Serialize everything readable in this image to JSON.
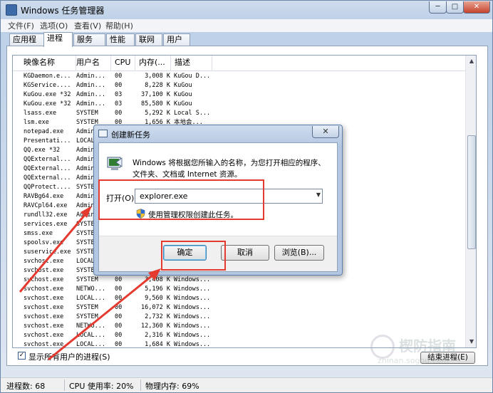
{
  "window": {
    "title": "Windows 任务管理器",
    "controls": {
      "minimize": "─",
      "maximize": "□",
      "close": "✕"
    }
  },
  "menu": [
    "文件(F)",
    "选项(O)",
    "查看(V)",
    "帮助(H)"
  ],
  "tabs": [
    "应用程序",
    "进程",
    "服务",
    "性能",
    "联网",
    "用户"
  ],
  "active_tab": "进程",
  "columns": [
    "映像名称",
    "用户名",
    "CPU",
    "内存(...",
    "描述"
  ],
  "processes": [
    [
      "KGDaemon.e...",
      "Admin...",
      "00",
      "3,008 K",
      "KuGou D..."
    ],
    [
      "KGService....",
      "Admin...",
      "00",
      "8,228 K",
      "KuGou"
    ],
    [
      "KuGou.exe *32",
      "Admin...",
      "03",
      "37,100 K",
      "KuGou"
    ],
    [
      "KuGou.exe *32",
      "Admin...",
      "03",
      "85,580 K",
      "KuGou"
    ],
    [
      "lsass.exe",
      "SYSTEM",
      "00",
      "5,292 K",
      "Local S..."
    ],
    [
      "lsm.exe",
      "SYSTEM",
      "00",
      "1,656 K",
      "本地会..."
    ],
    [
      "notepad.exe",
      "Admin...",
      "",
      "",
      ""
    ],
    [
      "Presentati...",
      "LOCAL...",
      "",
      "",
      ""
    ],
    [
      "QQ.exe *32",
      "Admin...",
      "",
      "",
      ""
    ],
    [
      "QQExternal...",
      "Admin...",
      "",
      "",
      ""
    ],
    [
      "QQExternal...",
      "Admin...",
      "",
      "",
      ""
    ],
    [
      "QQExternal...",
      "Admin...",
      "",
      "",
      ""
    ],
    [
      "QQProtect....",
      "SYSTEM",
      "",
      "",
      ""
    ],
    [
      "RAVBg64.exe",
      "Admin...",
      "",
      "",
      ""
    ],
    [
      "RAVCpl64.exe",
      "Admin...",
      "",
      "",
      ""
    ],
    [
      "rundll32.exe",
      "Admin...",
      "",
      "",
      ""
    ],
    [
      "services.exe",
      "SYSTEM",
      "",
      "",
      ""
    ],
    [
      "smss.exe",
      "SYSTEM",
      "",
      "",
      ""
    ],
    [
      "spoolsv.exe",
      "SYSTEM",
      "",
      "",
      ""
    ],
    [
      "suservice.exe",
      "SYSTEM",
      "",
      "",
      ""
    ],
    [
      "svchost.exe",
      "LOCAL...",
      "",
      "",
      ""
    ],
    [
      "svchost.exe",
      "SYSTEM",
      "",
      "",
      ""
    ],
    [
      "svchost.exe",
      "SYSTEM",
      "00",
      "3,408 K",
      "Windows..."
    ],
    [
      "svchost.exe",
      "NETWO...",
      "00",
      "5,196 K",
      "Windows..."
    ],
    [
      "svchost.exe",
      "LOCAL...",
      "00",
      "9,560 K",
      "Windows..."
    ],
    [
      "svchost.exe",
      "SYSTEM",
      "00",
      "16,072 K",
      "Windows..."
    ],
    [
      "svchost.exe",
      "SYSTEM",
      "00",
      "2,732 K",
      "Windows..."
    ],
    [
      "svchost.exe",
      "NETWO...",
      "00",
      "12,360 K",
      "Windows..."
    ],
    [
      "svchost.exe",
      "LOCAL...",
      "00",
      "2,316 K",
      "Windows..."
    ],
    [
      "svchost.exe",
      "LOCAL...",
      "00",
      "1,684 K",
      "Windows..."
    ]
  ],
  "show_all_users": {
    "label": "显示所有用户的进程(S)",
    "checked": true,
    "check": "✓"
  },
  "end_process_button": "结束进程(E)",
  "status": {
    "processes": "进程数: 68",
    "cpu": "CPU 使用率: 20%",
    "memory": "物理内存: 69%"
  },
  "run_dialog": {
    "title": "创建新任务",
    "close": "✕",
    "description": "Windows 将根据您所输入的名称，为您打开相应的程序、文件夹、文档或 Internet 资源。",
    "open_label": "打开(O):",
    "open_value": "explorer.exe",
    "admin_note": "使用管理权限创建此任务。",
    "ok": "确定",
    "cancel": "取消",
    "browse": "浏览(B)..."
  },
  "watermark": {
    "line1": "楔防指南",
    "line2": "zhinan.sogou.com"
  }
}
